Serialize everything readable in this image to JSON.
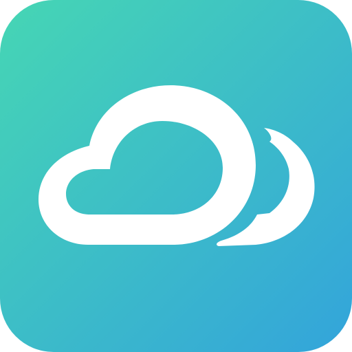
{
  "icon": {
    "name": "cloud-app-icon",
    "glyph": "cloud-icon",
    "gradient_start": "#46D6B4",
    "gradient_end": "#33A4DB",
    "glyph_color": "#FFFFFF"
  }
}
